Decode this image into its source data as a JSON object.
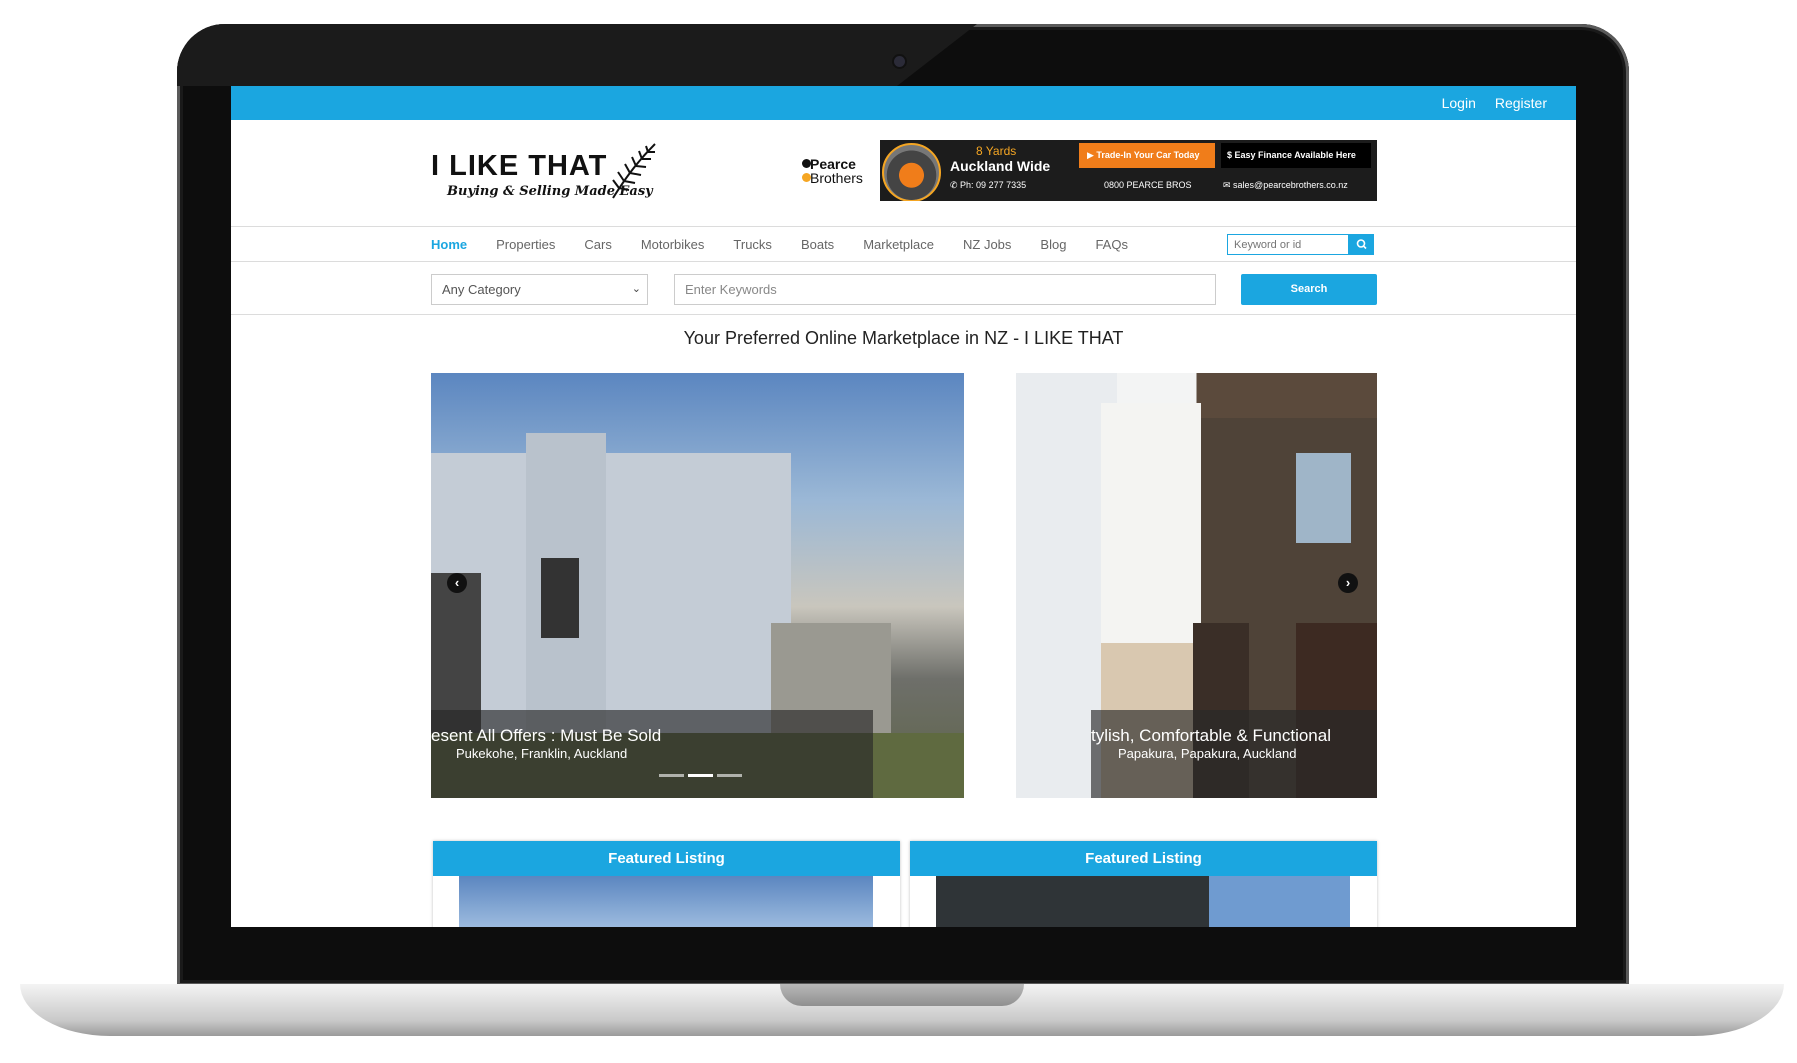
{
  "topbar": {
    "login": "Login",
    "register": "Register"
  },
  "logo": {
    "title": "I LIKE THAT",
    "tagline": "Buying & Selling Made Easy"
  },
  "ad": {
    "brand_line1": "Pearce",
    "brand_line2": "Brothers",
    "yards": "8 Yards",
    "area": "Auckland Wide",
    "phone": "Ph: 09 277 7335",
    "trade_in": "Trade-In Your Car Today",
    "finance": "Easy Finance Available Here",
    "freephone": "0800 PEARCE BROS",
    "email": "sales@pearcebrothers.co.nz"
  },
  "nav": {
    "items": [
      "Home",
      "Properties",
      "Cars",
      "Motorbikes",
      "Trucks",
      "Boats",
      "Marketplace",
      "NZ Jobs",
      "Blog",
      "FAQs"
    ],
    "search_placeholder": "Keyword or id"
  },
  "search": {
    "category": "Any Category",
    "keywords_placeholder": "Enter Keywords",
    "button": "Search"
  },
  "headline": "Your Preferred Online Marketplace in NZ - I LIKE THAT",
  "slides": [
    {
      "title": "esent All Offers : Must Be Sold",
      "location": "Pukekohe, Franklin, Auckland"
    },
    {
      "title": "tylish, Comfortable & Functional",
      "location": "Papakura, Papakura, Auckland"
    }
  ],
  "slider_dots": {
    "count": 3,
    "active": 2
  },
  "featured": [
    {
      "label": "Featured Listing"
    },
    {
      "label": "Featured Listing"
    }
  ],
  "colors": {
    "accent": "#1ba6e0",
    "ad_orange": "#f07d1a",
    "ad_yellow": "#f5a623"
  }
}
